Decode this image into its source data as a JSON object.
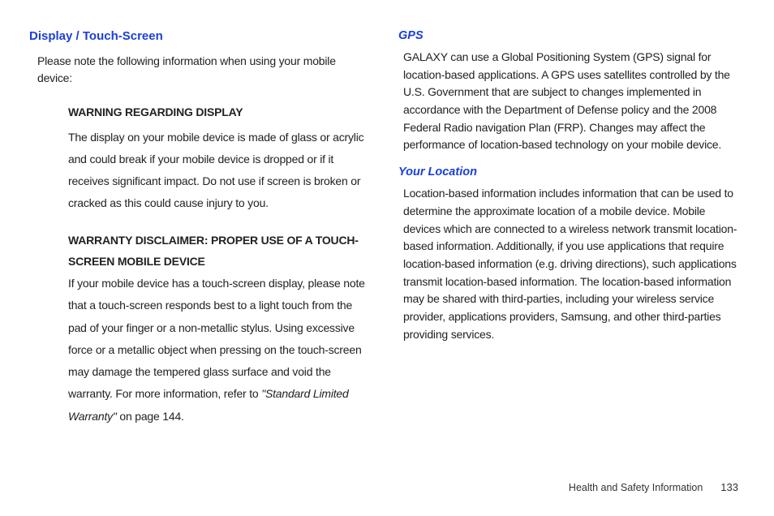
{
  "left": {
    "heading": "Display / Touch-Screen",
    "intro": "Please note the following information when using your mobile device:",
    "warn1_heading": "WARNING REGARDING DISPLAY",
    "warn1_body": "The display on your mobile device is made of glass or acrylic and could break if your mobile device is dropped or if it receives significant impact. Do not use if screen is broken or cracked as this could cause injury to you.",
    "warn2_heading": "WARRANTY DISCLAIMER: PROPER USE OF A TOUCH-SCREEN MOBILE DEVICE",
    "warn2_body_pre": "If your mobile device has a touch-screen display, please note that a touch-screen responds best to a light touch from the pad of your finger or a non-metallic stylus. Using excessive force or a metallic object when pressing on the touch-screen may damage the tempered glass surface and void the warranty. For more information, refer to ",
    "warn2_ref": "\"Standard Limited Warranty\"",
    "warn2_body_post": " on page 144."
  },
  "right": {
    "gps_heading": "GPS",
    "gps_body": "GALAXY can use a Global Positioning System (GPS) signal for location-based applications. A GPS uses satellites controlled by the U.S. Government that are subject to changes implemented in accordance with the Department of Defense policy and the 2008 Federal Radio navigation Plan (FRP). Changes may affect the performance of location-based technology on your mobile device.",
    "loc_heading": "Your Location",
    "loc_body": "Location-based information includes information that can be used to determine the approximate location of a mobile device. Mobile devices which are connected to a wireless network transmit location-based information. Additionally, if you use applications that require location-based information (e.g. driving directions), such applications transmit location-based information. The location-based information may be shared with third-parties, including your wireless service provider, applications providers, Samsung, and other third-parties providing services."
  },
  "footer": {
    "section": "Health and Safety Information",
    "page": "133"
  }
}
